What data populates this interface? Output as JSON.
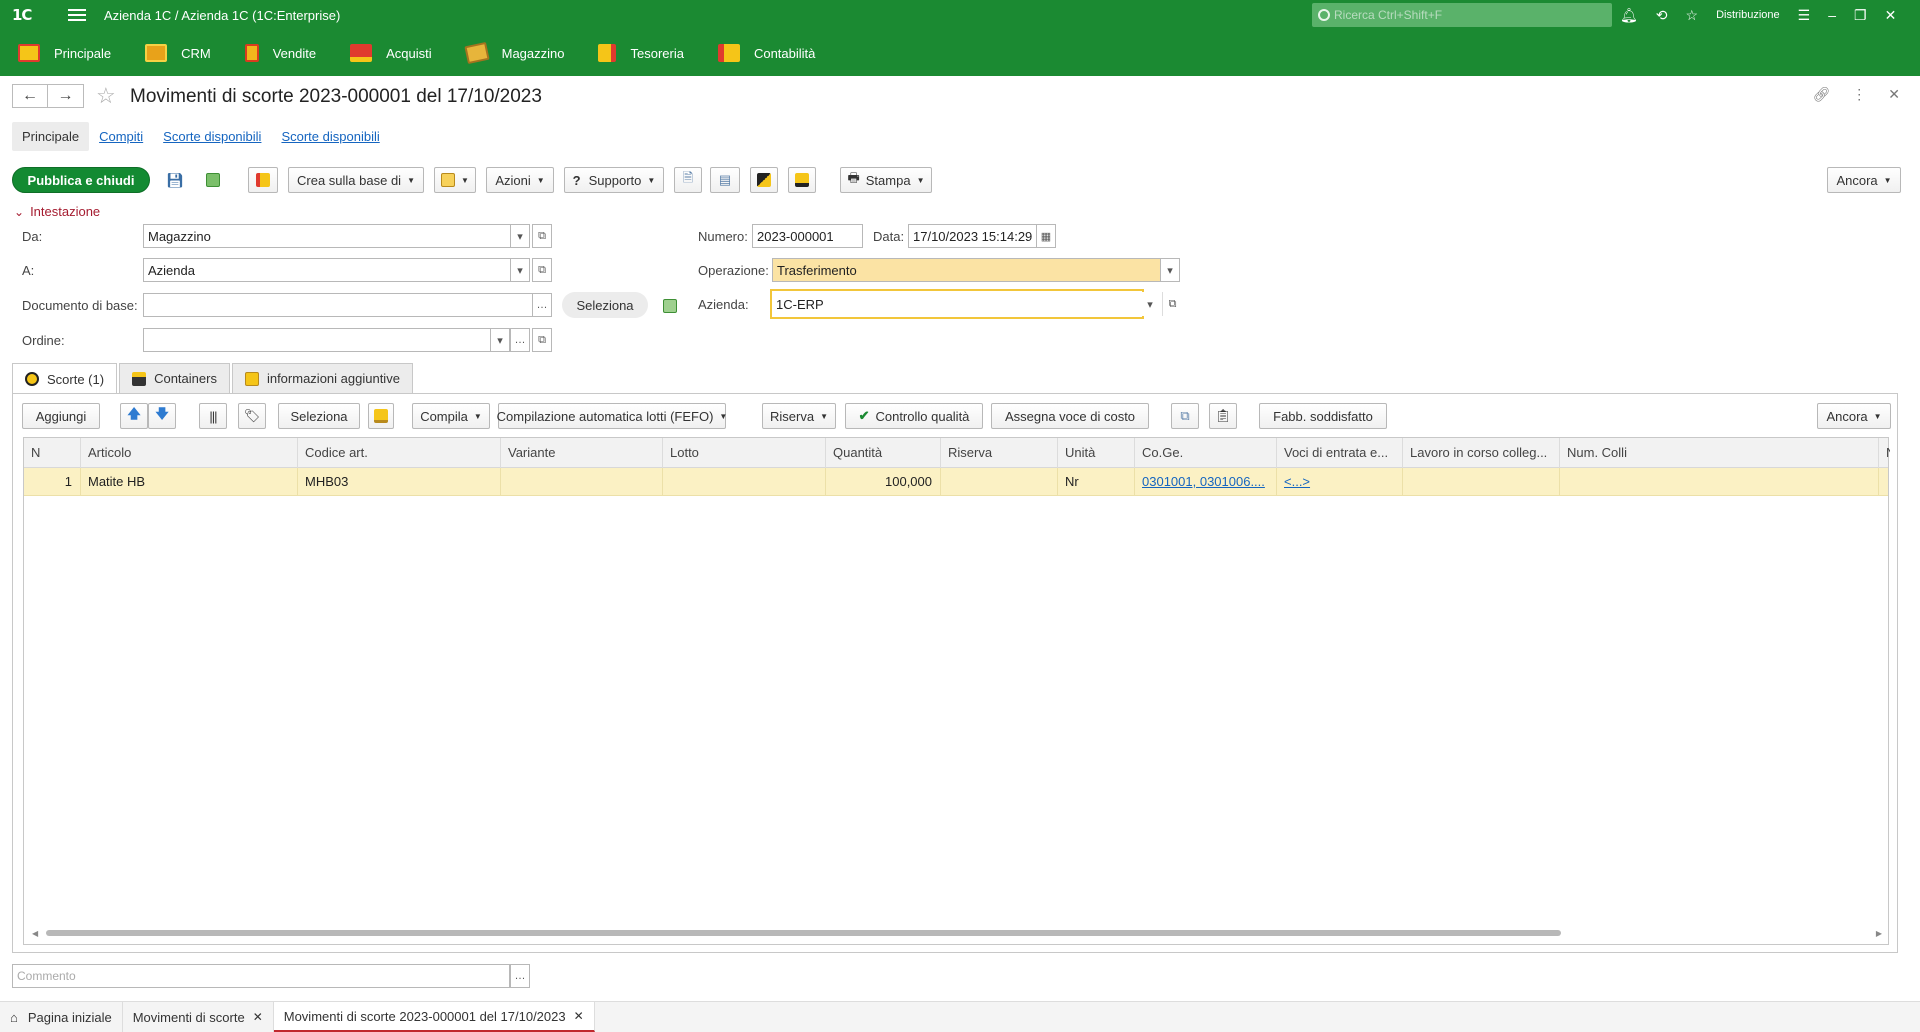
{
  "app": {
    "logo": "1С",
    "title": "Azienda 1C / Azienda 1C  (1C:Enterprise)",
    "search_placeholder": "Ricerca Ctrl+Shift+F",
    "user_menu": "Distribuzione"
  },
  "sections": [
    {
      "label": "Principale",
      "icon": "home-section-icon"
    },
    {
      "label": "CRM",
      "icon": "crm-icon"
    },
    {
      "label": "Vendite",
      "icon": "sales-icon"
    },
    {
      "label": "Acquisti",
      "icon": "truck-icon"
    },
    {
      "label": "Magazzino",
      "icon": "box-icon"
    },
    {
      "label": "Tesoreria",
      "icon": "treasury-icon"
    },
    {
      "label": "Contabilità",
      "icon": "accounting-icon"
    }
  ],
  "document": {
    "title": "Movimenti di scorte 2023-000001 del 17/10/2023",
    "form_tabs": [
      "Principale",
      "Compiti",
      "Scorte disponibili",
      "Scorte disponibili"
    ]
  },
  "commands": {
    "post_close": "Pubblica e chiudi",
    "create_based": "Crea sulla base di",
    "actions": "Azioni",
    "support": "Supporto",
    "print": "Stampa",
    "more": "Ancora"
  },
  "header_group": {
    "title": "Intestazione",
    "from_label": "Da:",
    "from_value": "Magazzino",
    "to_label": "A:",
    "to_value": "Azienda",
    "base_doc_label": "Documento di base:",
    "base_doc_value": "",
    "select_button": "Seleziona",
    "order_label": "Ordine:",
    "order_value": "",
    "number_label": "Numero:",
    "number_value": "2023-000001",
    "date_label": "Data:",
    "date_value": "17/10/2023 15:14:29",
    "operation_label": "Operazione:",
    "operation_value": "Trasferimento",
    "company_label": "Azienda:",
    "company_value": "1C-ERP"
  },
  "inner_tabs": [
    {
      "label": "Scorte (1)",
      "active": true
    },
    {
      "label": "Containers",
      "active": false
    },
    {
      "label": "informazioni aggiuntive",
      "active": false
    }
  ],
  "table_toolbar": {
    "add": "Aggiungi",
    "select": "Seleziona",
    "fill": "Compila",
    "fefo": "Compilazione automatica lotti (FEFO)",
    "reserve": "Riserva",
    "quality": "Controllo qualità",
    "cost_item": "Assegna voce di costo",
    "need_satisfied": "Fabb. soddisfatto",
    "more": "Ancora"
  },
  "table": {
    "columns": [
      "N",
      "Articolo",
      "Codice art.",
      "Variante",
      "Lotto",
      "Quantità",
      "Riserva",
      "Unità",
      "Co.Ge.",
      "Voci di entrata e...",
      "Lavoro in corso colleg...",
      "Num. Colli",
      "N"
    ],
    "rows": [
      {
        "n": "1",
        "articolo": "Matite HB",
        "codice": "MHB03",
        "variante": "",
        "lotto": "",
        "quantita": "100,000",
        "riserva": "",
        "unita": "Nr",
        "coge": "0301001, 0301006....",
        "voci": "<...>",
        "lavoro": "",
        "colli": ""
      }
    ]
  },
  "comment_placeholder": "Commento",
  "bottom_tabs": [
    {
      "label": "Pagina iniziale",
      "closable": false
    },
    {
      "label": "Movimenti di scorte",
      "closable": true
    },
    {
      "label": "Movimenti di scorte 2023-000001 del 17/10/2023",
      "closable": true
    }
  ],
  "colors": {
    "brand_green": "#1b8a32",
    "header_accent": "#a51c30",
    "selected_row": "#fbf1c4",
    "operation_field": "#fbe3a4"
  }
}
